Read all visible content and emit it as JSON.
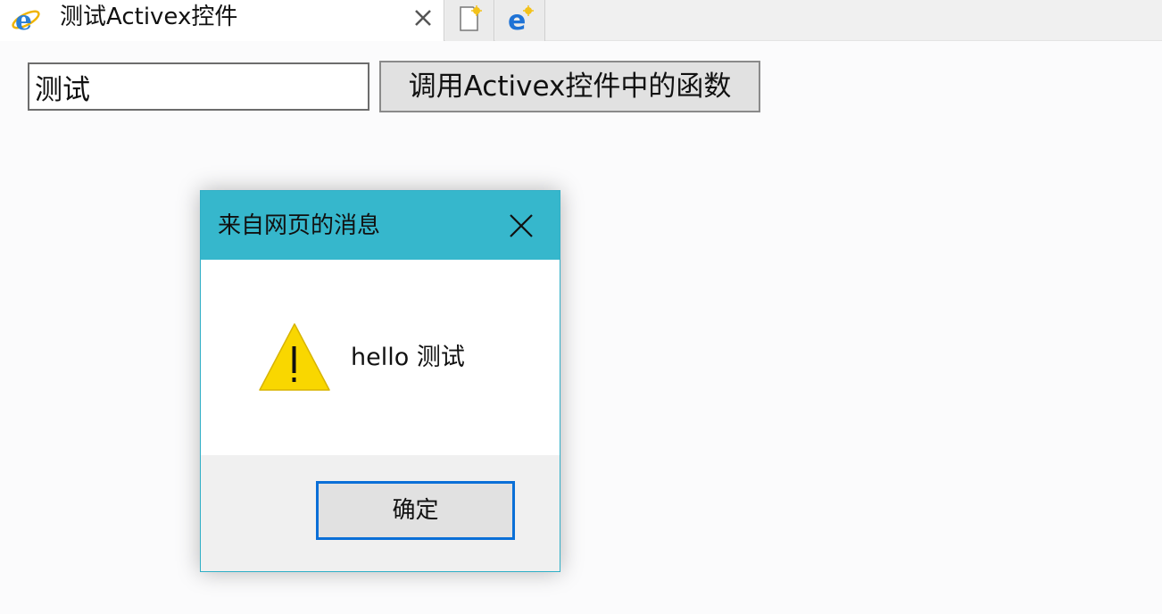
{
  "browser": {
    "tab_title": "测试Activex控件",
    "tab_favicon": "ie-icon",
    "close_tab_icon": "close-icon",
    "new_tab_icon": "new-tab-icon",
    "edge_icon": "edge-icon"
  },
  "page": {
    "input_value": "测试",
    "button_label": "调用Activex控件中的函数"
  },
  "dialog": {
    "title": "来自网页的消息",
    "close_icon": "close-icon",
    "icon": "warning-icon",
    "message": "hello 测试",
    "ok_label": "确定"
  },
  "colors": {
    "dialog_titlebar": "#36b7cc",
    "ok_button_border": "#0a6fd7",
    "warning_fill": "#f9d700"
  }
}
